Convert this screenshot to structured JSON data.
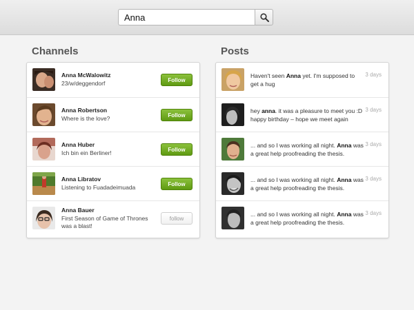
{
  "search": {
    "value": "Anna"
  },
  "channels": {
    "title": "Channels",
    "items": [
      {
        "name": "Anna McWalowitz",
        "sub": "23/w/deggendorf",
        "follow": "Follow",
        "following": false
      },
      {
        "name": "Anna Robertson",
        "sub": "Where is the love?",
        "follow": "Follow",
        "following": false
      },
      {
        "name": "Anna Huber",
        "sub": "Ich bin ein Berliner!",
        "follow": "Follow",
        "following": false
      },
      {
        "name": "Anna Libratov",
        "sub": "Listening to Fuadadeimuada",
        "follow": "Follow",
        "following": false
      },
      {
        "name": "Anna Bauer",
        "sub": "First Season of Game of Thrones was a blast!",
        "follow": "follow",
        "following": true
      }
    ]
  },
  "posts": {
    "title": "Posts",
    "items": [
      {
        "pre": "Haven't seen ",
        "hl": "Anna",
        "post": " yet. I'm supposed to get a hug",
        "time": "3 days"
      },
      {
        "pre": "hey ",
        "hl": "anna",
        "post": ". it was a pleasure to meet you :D happy birthday – hope we meet again",
        "time": "3 days"
      },
      {
        "pre": "... and so I was working all night. ",
        "hl": "Anna",
        "post": " was a great help proofreading the thesis.",
        "time": "3 days"
      },
      {
        "pre": "... and so I was working all night. ",
        "hl": "Anna",
        "post": " was a great help proofreading the thesis.",
        "time": "3 days"
      },
      {
        "pre": "... and so I was working all night. ",
        "hl": "Anna",
        "post": " was a great help proofreading the thesis.",
        "time": "3 days"
      }
    ]
  },
  "icons": {
    "search": "search-icon"
  },
  "colors": {
    "accent": "#6fa81f",
    "timestamp": "#aaaaaa"
  }
}
